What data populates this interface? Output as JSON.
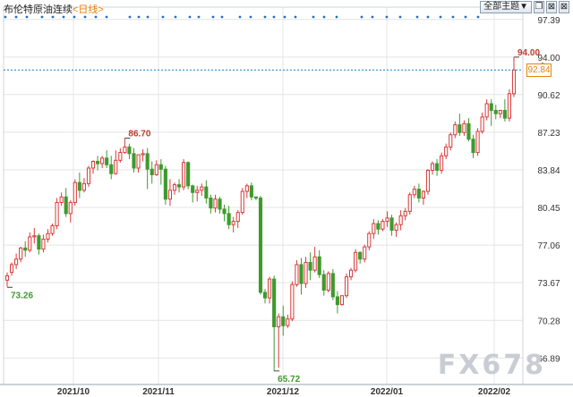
{
  "header": {
    "title": "布伦特原油连续",
    "period": "<日线>",
    "main_menu_label": "全部主题▼",
    "icons": [
      "window-restore-icon",
      "window-close-icon",
      "window-close-icon"
    ]
  },
  "watermark": "FX678",
  "current_price_label": "92.84",
  "chart_data": {
    "type": "candlestick",
    "x_labels": [
      "2021/10",
      "2021/11",
      "2021/12",
      "2022/01",
      "2022/02"
    ],
    "y_ticks": [
      "97.39",
      "94.00",
      "90.62",
      "87.23",
      "83.84",
      "80.45",
      "77.06",
      "73.67",
      "70.28",
      "66.89"
    ],
    "ylim": [
      64.5,
      98.5
    ],
    "current_price": 92.84,
    "annotations": [
      {
        "label": "73.26",
        "value": 73.26,
        "type": "low",
        "index": 0
      },
      {
        "label": "86.70",
        "value": 86.7,
        "type": "high",
        "index": 26
      },
      {
        "label": "65.72",
        "value": 65.72,
        "type": "low",
        "index": 59
      },
      {
        "label": "94.00",
        "value": 94.0,
        "type": "high",
        "index": 112
      }
    ],
    "colors": {
      "up": "#d93a3a",
      "down": "#3f9a2e",
      "grid": "#e4e4e4",
      "current": "#1a7fc2"
    },
    "candles": [
      [
        73.9,
        74.6,
        74.3,
        73.3
      ],
      [
        74.6,
        75.5,
        75.3,
        74.3
      ],
      [
        75.3,
        76.3,
        75.8,
        74.9
      ],
      [
        75.8,
        76.9,
        76.8,
        75.5
      ],
      [
        76.8,
        77.4,
        76.6,
        76.0
      ],
      [
        76.6,
        78.2,
        77.8,
        76.4
      ],
      [
        77.8,
        78.6,
        77.9,
        77.2
      ],
      [
        77.9,
        78.1,
        76.7,
        76.2
      ],
      [
        76.7,
        78.0,
        77.6,
        76.4
      ],
      [
        77.6,
        78.5,
        78.1,
        77.3
      ],
      [
        78.1,
        79.0,
        78.8,
        77.9
      ],
      [
        78.8,
        81.3,
        80.9,
        78.5
      ],
      [
        80.9,
        81.8,
        81.4,
        80.6
      ],
      [
        81.4,
        82.2,
        79.9,
        79.6
      ],
      [
        79.9,
        81.1,
        80.9,
        79.1
      ],
      [
        80.9,
        83.0,
        82.7,
        80.6
      ],
      [
        82.7,
        83.6,
        82.0,
        81.3
      ],
      [
        82.0,
        83.1,
        82.6,
        81.8
      ],
      [
        82.6,
        84.2,
        84.0,
        82.3
      ],
      [
        84.0,
        84.7,
        84.6,
        83.5
      ],
      [
        84.6,
        85.1,
        84.4,
        83.8
      ],
      [
        84.4,
        85.1,
        84.9,
        84.0
      ],
      [
        84.9,
        85.6,
        84.3,
        84.0
      ],
      [
        84.3,
        85.1,
        83.5,
        83.0
      ],
      [
        83.5,
        85.6,
        84.7,
        83.4
      ],
      [
        84.7,
        85.8,
        85.4,
        84.5
      ],
      [
        85.4,
        86.7,
        85.9,
        85.3
      ],
      [
        85.9,
        86.2,
        85.3,
        84.8
      ],
      [
        85.3,
        85.8,
        84.0,
        83.6
      ],
      [
        84.0,
        84.7,
        85.2,
        83.6
      ],
      [
        85.2,
        85.7,
        85.3,
        84.6
      ],
      [
        85.3,
        85.8,
        83.9,
        82.1
      ],
      [
        83.9,
        84.6,
        83.4,
        82.6
      ],
      [
        83.4,
        84.7,
        84.3,
        83.3
      ],
      [
        84.3,
        84.8,
        83.9,
        82.5
      ],
      [
        83.9,
        84.2,
        81.2,
        80.7
      ],
      [
        81.2,
        83.0,
        82.0,
        80.6
      ],
      [
        82.0,
        82.7,
        82.5,
        81.6
      ],
      [
        82.5,
        83.0,
        82.3,
        81.8
      ],
      [
        82.3,
        84.8,
        84.5,
        82.0
      ],
      [
        84.5,
        84.6,
        82.4,
        82.1
      ],
      [
        82.4,
        82.5,
        81.8,
        80.9
      ],
      [
        81.8,
        82.4,
        82.0,
        81.0
      ],
      [
        82.0,
        82.6,
        82.3,
        81.5
      ],
      [
        82.3,
        82.9,
        81.3,
        80.8
      ],
      [
        81.3,
        81.6,
        80.4,
        79.9
      ],
      [
        80.4,
        81.6,
        81.2,
        80.0
      ],
      [
        81.2,
        81.4,
        80.3,
        79.9
      ],
      [
        80.3,
        80.7,
        79.9,
        79.2
      ],
      [
        79.9,
        80.6,
        78.9,
        78.5
      ],
      [
        78.9,
        79.6,
        79.2,
        78.2
      ],
      [
        79.2,
        80.2,
        80.0,
        78.6
      ],
      [
        80.0,
        82.2,
        81.9,
        79.8
      ],
      [
        81.9,
        82.6,
        82.4,
        81.3
      ],
      [
        82.4,
        82.7,
        81.4,
        81.1
      ],
      [
        81.4,
        81.3,
        81.3,
        81.1
      ],
      [
        81.3,
        81.5,
        72.8,
        72.6
      ],
      [
        72.8,
        73.1,
        72.3,
        71.8
      ],
      [
        72.3,
        74.2,
        74.0,
        71.8
      ],
      [
        74.0,
        74.3,
        69.7,
        65.7
      ],
      [
        69.7,
        70.9,
        70.6,
        66.0
      ],
      [
        70.6,
        71.6,
        69.8,
        68.9
      ],
      [
        69.8,
        70.8,
        70.4,
        69.6
      ],
      [
        70.4,
        73.8,
        73.5,
        70.2
      ],
      [
        73.5,
        75.7,
        75.3,
        73.3
      ],
      [
        75.3,
        75.9,
        73.6,
        72.6
      ],
      [
        73.6,
        76.0,
        75.5,
        73.2
      ],
      [
        75.5,
        76.4,
        74.8,
        73.9
      ],
      [
        74.8,
        76.9,
        76.0,
        74.6
      ],
      [
        76.0,
        76.6,
        74.4,
        74.1
      ],
      [
        74.4,
        74.8,
        73.0,
        72.5
      ],
      [
        73.0,
        74.7,
        74.5,
        72.8
      ],
      [
        74.5,
        74.9,
        72.4,
        72.1
      ],
      [
        72.4,
        72.9,
        71.7,
        70.9
      ],
      [
        71.7,
        72.3,
        72.5,
        71.6
      ],
      [
        72.5,
        74.5,
        74.2,
        72.3
      ],
      [
        74.2,
        75.0,
        74.8,
        73.9
      ],
      [
        74.8,
        76.7,
        76.4,
        74.6
      ],
      [
        76.4,
        76.5,
        75.8,
        75.4
      ],
      [
        75.8,
        77.1,
        76.9,
        75.5
      ],
      [
        76.9,
        78.3,
        78.1,
        76.6
      ],
      [
        78.1,
        79.4,
        79.0,
        77.6
      ],
      [
        79.0,
        79.3,
        78.5,
        78.0
      ],
      [
        78.5,
        79.4,
        79.2,
        78.3
      ],
      [
        79.2,
        80.1,
        79.5,
        78.7
      ],
      [
        79.5,
        79.8,
        78.4,
        77.9
      ],
      [
        78.4,
        79.1,
        78.9,
        77.8
      ],
      [
        78.9,
        80.2,
        79.7,
        78.4
      ],
      [
        79.7,
        80.4,
        80.1,
        79.3
      ],
      [
        80.1,
        81.8,
        81.6,
        79.8
      ],
      [
        81.6,
        82.4,
        82.1,
        81.3
      ],
      [
        82.1,
        82.6,
        81.3,
        80.9
      ],
      [
        81.3,
        82.0,
        81.9,
        80.7
      ],
      [
        81.9,
        83.9,
        83.8,
        81.6
      ],
      [
        83.8,
        84.6,
        84.4,
        83.4
      ],
      [
        84.4,
        84.8,
        83.8,
        83.3
      ],
      [
        83.8,
        85.4,
        85.1,
        83.5
      ],
      [
        85.1,
        86.2,
        85.9,
        84.8
      ],
      [
        85.9,
        87.2,
        87.0,
        85.6
      ],
      [
        87.0,
        88.2,
        87.9,
        86.7
      ],
      [
        87.9,
        88.9,
        87.2,
        86.9
      ],
      [
        87.2,
        88.3,
        88.0,
        86.9
      ],
      [
        88.0,
        88.5,
        86.6,
        86.4
      ],
      [
        86.6,
        87.0,
        85.4,
        84.9
      ],
      [
        85.4,
        87.6,
        87.3,
        85.1
      ],
      [
        87.3,
        89.0,
        88.6,
        87.1
      ],
      [
        88.6,
        90.2,
        89.8,
        88.3
      ],
      [
        89.8,
        90.2,
        89.2,
        87.8
      ],
      [
        89.2,
        89.7,
        88.9,
        88.4
      ],
      [
        88.9,
        89.1,
        89.2,
        88.5
      ],
      [
        89.2,
        90.2,
        88.5,
        88.2
      ],
      [
        88.5,
        91.1,
        90.7,
        88.2
      ],
      [
        90.7,
        94.0,
        92.84,
        90.4
      ]
    ]
  }
}
